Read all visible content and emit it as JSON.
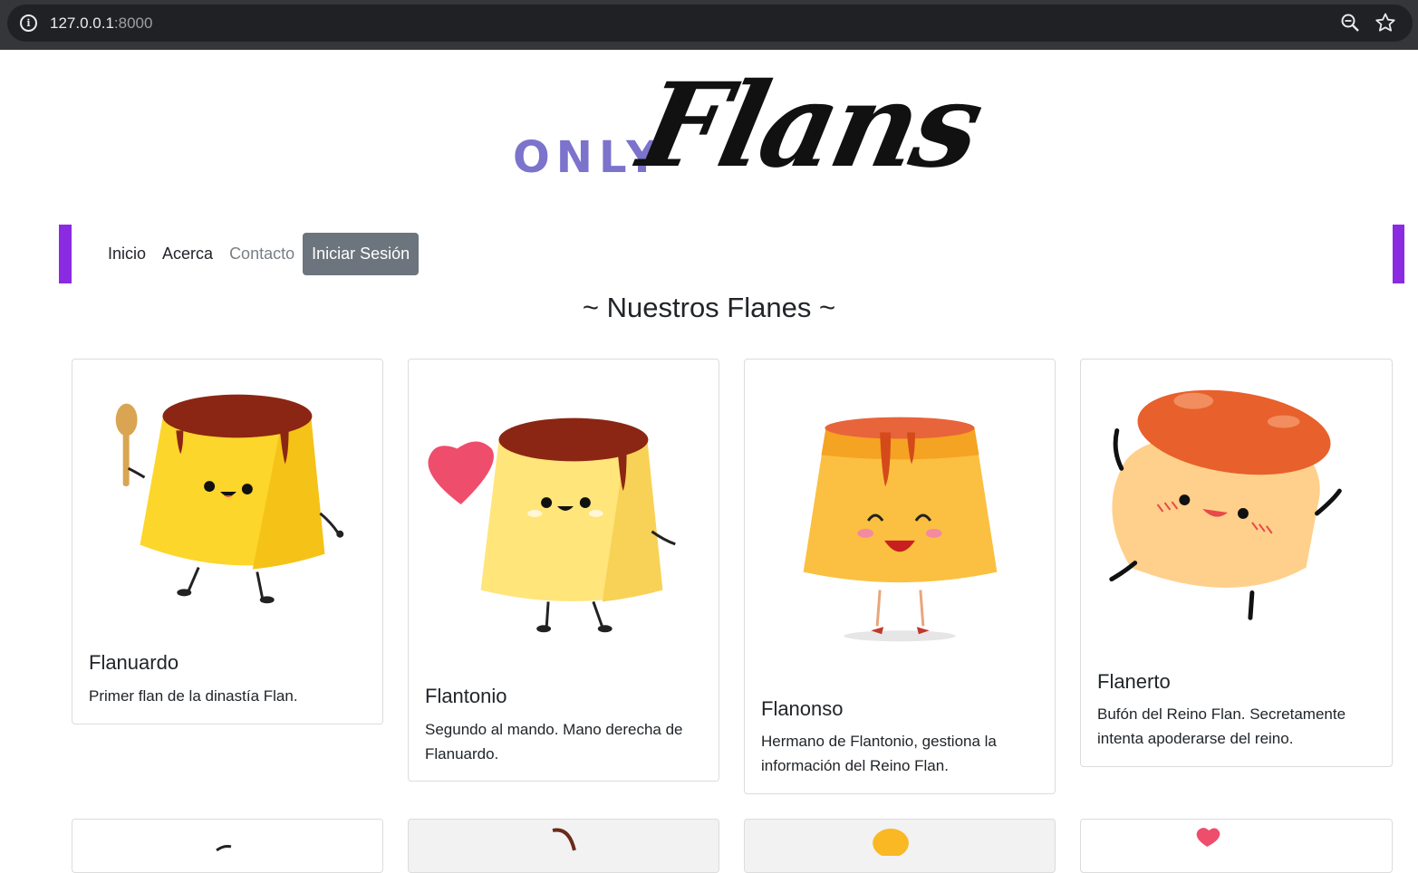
{
  "browser": {
    "url_host": "127.0.0.1",
    "url_port": ":8000"
  },
  "logo": {
    "only": "ONLY",
    "flans": "Flans"
  },
  "nav": {
    "items": [
      {
        "label": "Inicio"
      },
      {
        "label": "Acerca"
      },
      {
        "label": "Contacto"
      }
    ],
    "login_label": "Iniciar Sesión"
  },
  "section": {
    "title": "~ Nuestros Flanes ~"
  },
  "cards": [
    {
      "name": "Flanuardo",
      "description": "Primer flan de la dinastía Flan."
    },
    {
      "name": "Flantonio",
      "description": "Segundo al mando. Mano derecha de Flanuardo."
    },
    {
      "name": "Flanonso",
      "description": "Hermano de Flantonio, gestiona la información del Reino Flan."
    },
    {
      "name": "Flanerto",
      "description": "Bufón del Reino Flan. Secretamente intenta apoderarse del reino."
    }
  ],
  "colors": {
    "accent_purple": "#8a2be2",
    "logo_purple": "#7b73cc",
    "login_button": "#6c757d"
  }
}
